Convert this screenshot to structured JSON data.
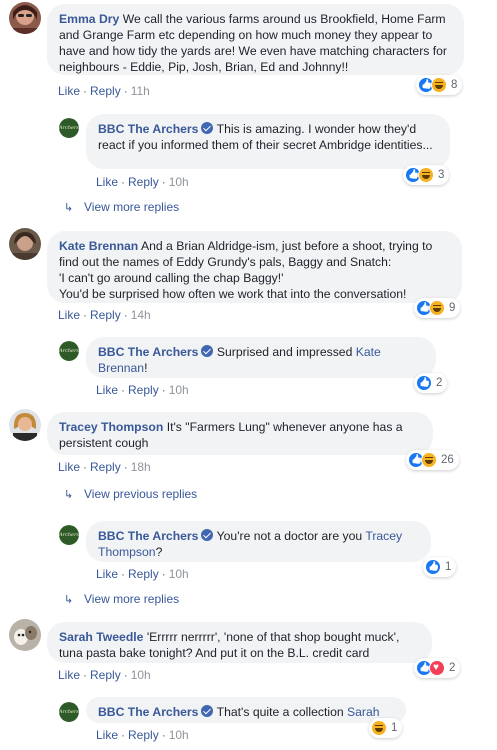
{
  "colors": {
    "link": "#385898",
    "bubble": "#f2f3f5",
    "meta": "#90949c"
  },
  "actions": {
    "like": "Like",
    "reply": "Reply"
  },
  "comments": [
    {
      "author": "Emma Dry",
      "text": "We call the various farms around us Brookfield, Home Farm and Grange Farm etc depending on how much money they appear to have and how tidy the yards are! We even have matching characters for neighbours - Eddie, Pip, Josh, Brian, Ed and Johnny!!",
      "time": "11h",
      "reactions": [
        "like",
        "haha"
      ],
      "reaction_count": "8"
    },
    {
      "author": "BBC The Archers",
      "verified": true,
      "text": "This is amazing. I wonder how they'd react if you informed them of their secret Ambridge identities...",
      "time": "10h",
      "reactions": [
        "like",
        "haha"
      ],
      "reaction_count": "3"
    },
    {
      "author": "Kate Brennan",
      "text_lines": [
        "And a Brian Aldridge-ism, just before a shoot, trying to find out the names of Eddy Grundy's pals, Baggy and Snatch:",
        "'I can't go around calling the chap Baggy!'",
        "You'd be surprised how often we work that into the conversation!"
      ],
      "time": "14h",
      "reactions": [
        "like",
        "haha"
      ],
      "reaction_count": "9"
    },
    {
      "author": "BBC The Archers",
      "verified": true,
      "text": "Surprised and impressed",
      "mention": "Kate Brennan",
      "suffix": "!",
      "time": "10h",
      "reactions": [
        "like"
      ],
      "reaction_count": "2"
    },
    {
      "author": "Tracey Thompson",
      "text": "It's \"Farmers Lung\" whenever anyone has a persistent cough",
      "time": "18h",
      "reactions": [
        "like",
        "haha"
      ],
      "reaction_count": "26"
    },
    {
      "author": "BBC The Archers",
      "verified": true,
      "text": "You're not a doctor are you",
      "mention": "Tracey Thompson",
      "suffix": "?",
      "time": "10h",
      "reactions": [
        "like"
      ],
      "reaction_count": "1"
    },
    {
      "author": "Sarah Tweedle",
      "text": "'Errrrr nerrrrr', 'none of that shop bought muck', tuna pasta bake tonight? And put it on the B.L. credit card",
      "time": "10h",
      "reactions": [
        "like",
        "love"
      ],
      "reaction_count": "2"
    },
    {
      "author": "BBC The Archers",
      "verified": true,
      "text": "That's quite a collection",
      "mention": "Sarah",
      "suffix": "",
      "time": "10h",
      "reactions": [
        "haha"
      ],
      "reaction_count": "1"
    }
  ],
  "view_more_replies": "View more replies",
  "view_previous_replies": "View previous replies",
  "logo_text": "Archers"
}
